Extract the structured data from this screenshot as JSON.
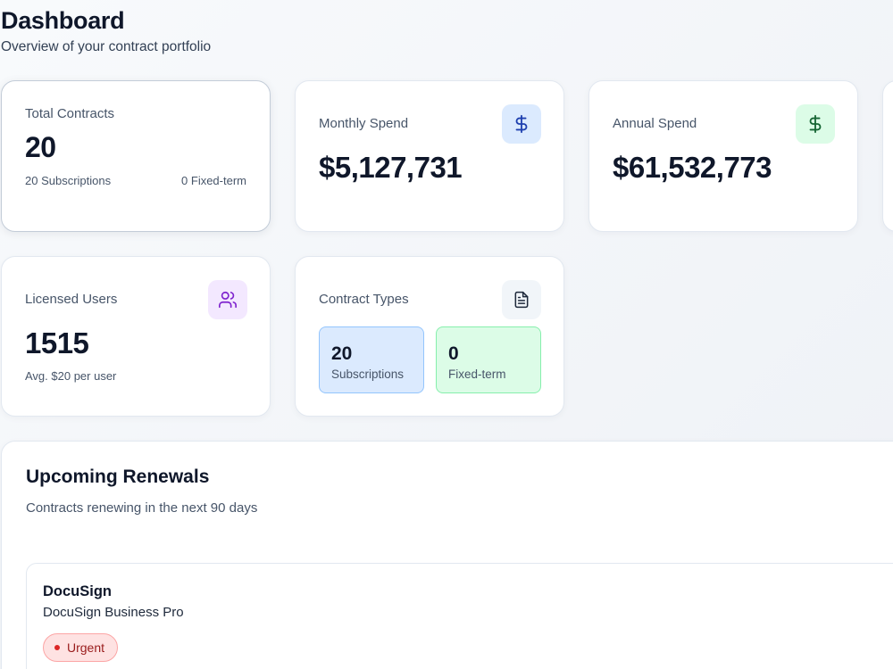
{
  "header": {
    "title": "Dashboard",
    "subtitle": "Overview of your contract portfolio"
  },
  "stats": {
    "total_contracts": {
      "label": "Total Contracts",
      "value": "20",
      "subscriptions": "20 Subscriptions",
      "fixed_term": "0 Fixed-term"
    },
    "monthly_spend": {
      "label": "Monthly Spend",
      "value": "$5,127,731",
      "icon": "dollar-icon",
      "accent": "#1e40af",
      "icon_bg": "#dbeafe"
    },
    "annual_spend": {
      "label": "Annual Spend",
      "value": "$61,532,773",
      "icon": "dollar-icon",
      "accent": "#166534",
      "icon_bg": "#dcfce7"
    },
    "licensed_users": {
      "label": "Licensed Users",
      "value": "1515",
      "sub": "Avg. $20 per user",
      "icon": "users-icon",
      "accent": "#7e22ce",
      "icon_bg": "#f3e8ff"
    },
    "contract_types": {
      "label": "Contract Types",
      "icon": "document-icon",
      "subscriptions": {
        "value": "20",
        "label": "Subscriptions",
        "bg": "#dbeafe",
        "border": "#93c5fd"
      },
      "fixed_term": {
        "value": "0",
        "label": "Fixed-term",
        "bg": "#dcfce7",
        "border": "#86efac"
      }
    }
  },
  "renewals": {
    "title": "Upcoming Renewals",
    "subtitle": "Contracts renewing in the next 90 days",
    "items": [
      {
        "vendor": "DocuSign",
        "product": "DocuSign Business Pro",
        "badge": "Urgent",
        "badge_color": "#dc2626"
      }
    ]
  }
}
